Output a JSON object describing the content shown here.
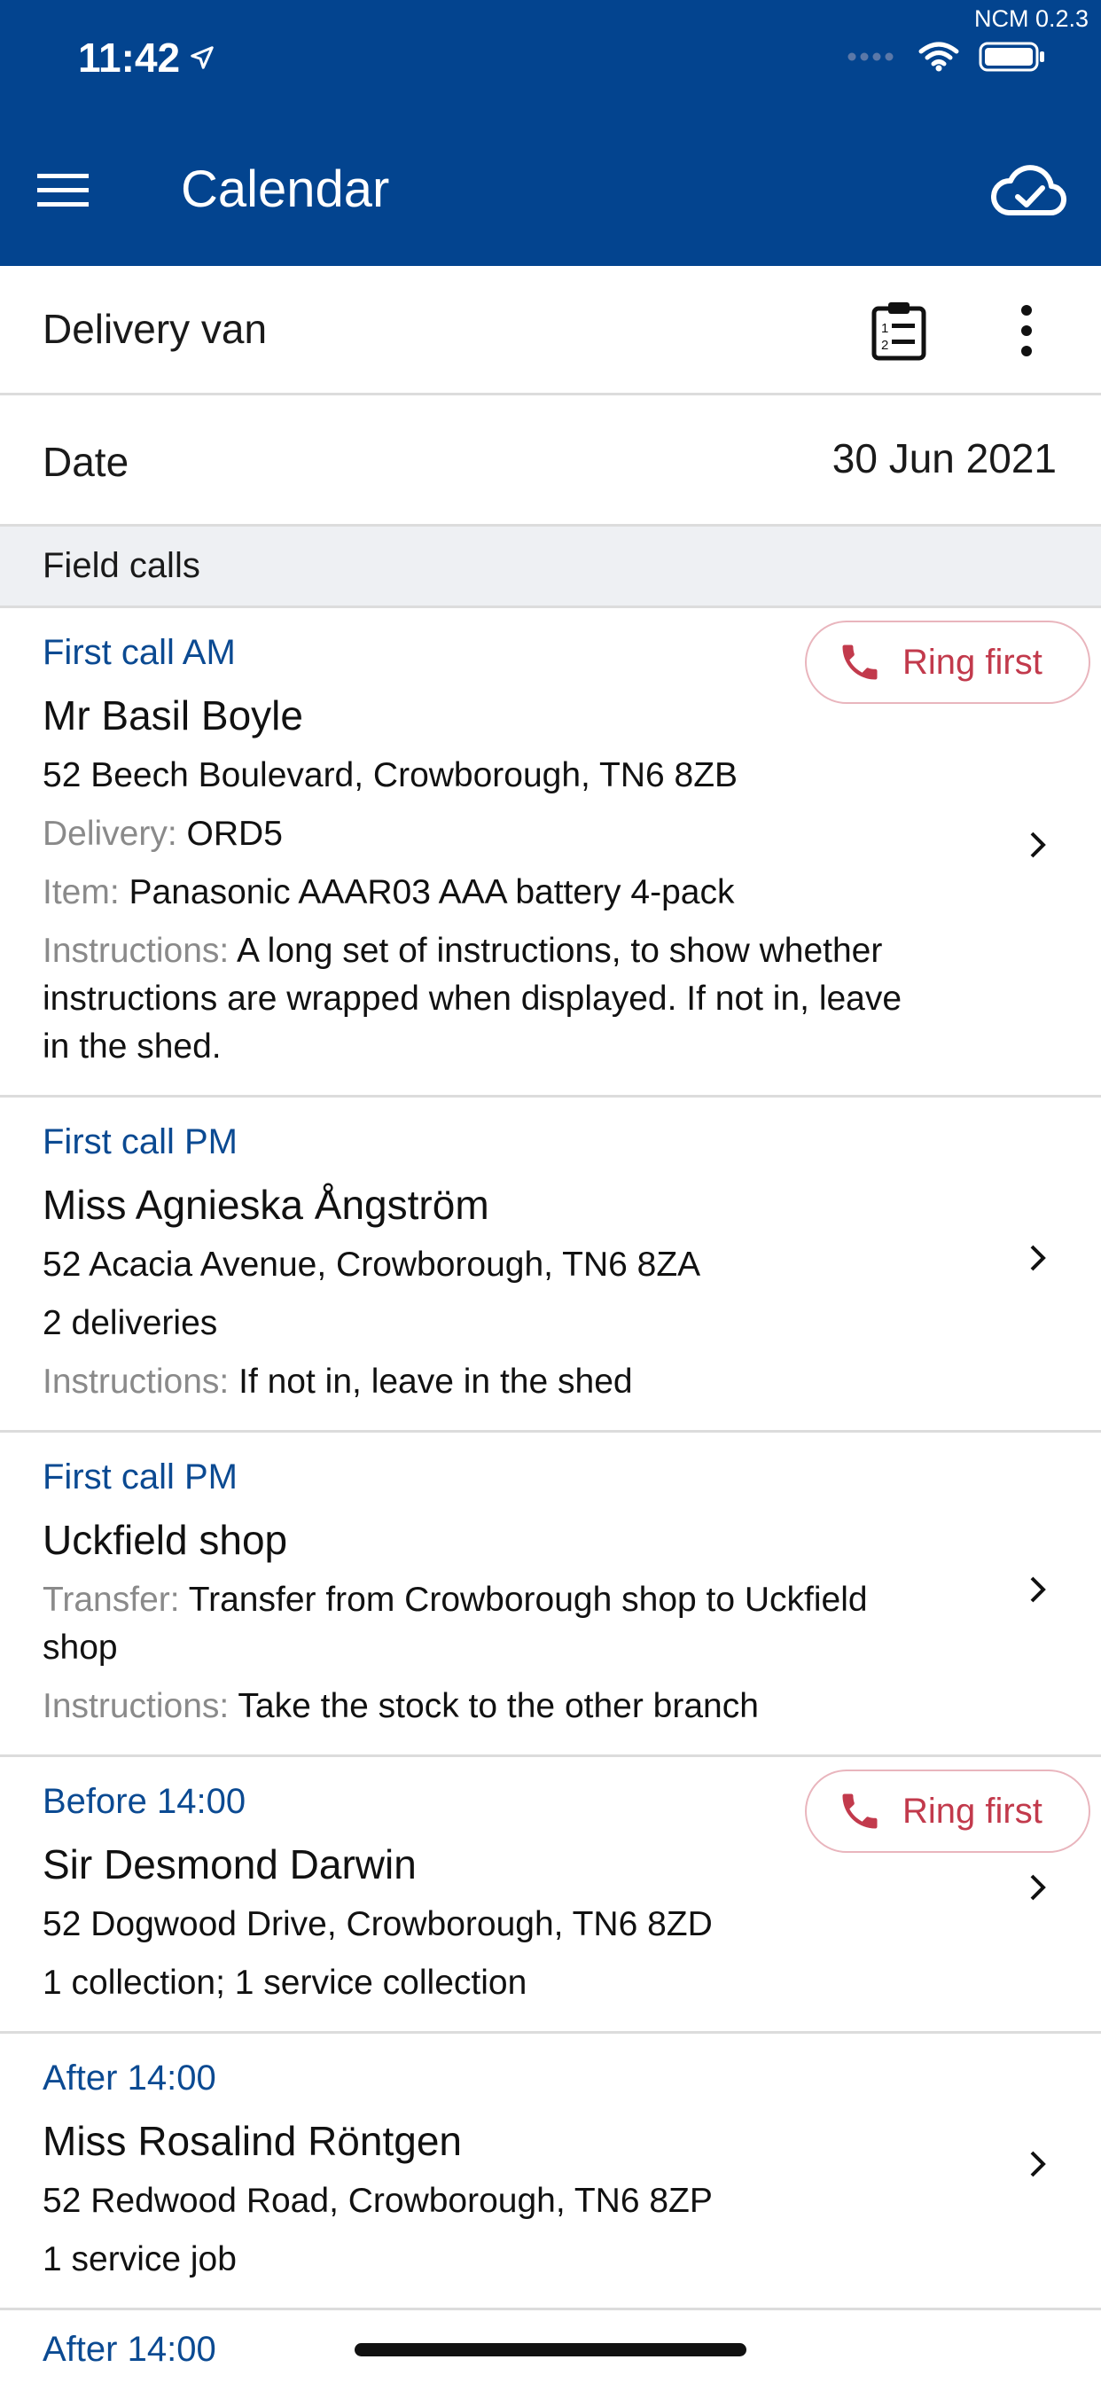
{
  "status_bar": {
    "time": "11:42",
    "version": "NCM 0.2.3"
  },
  "appbar": {
    "title": "Calendar"
  },
  "van": {
    "label": "Delivery van"
  },
  "date": {
    "label": "Date",
    "value": "30 Jun 2021"
  },
  "section": {
    "label": "Field calls"
  },
  "ring_label": "Ring first",
  "calls": [
    {
      "slot": "First call AM",
      "name": "Mr Basil Boyle",
      "address": "52 Beech Boulevard, Crowborough, TN6 8ZB",
      "delivery_label": "Delivery:",
      "delivery_value": "ORD5",
      "item_label": "Item:",
      "item_value": "Panasonic AAAR03 AAA battery 4-pack",
      "instructions_label": "Instructions:",
      "instructions_value": "A long set of instructions, to show whether instructions are wrapped when displayed. If not in, leave in the shed."
    },
    {
      "slot": "First call PM",
      "name": "Miss Agnieska Ångström",
      "address": "52 Acacia Avenue, Crowborough, TN6 8ZA",
      "summary": "2 deliveries",
      "instructions_label": "Instructions:",
      "instructions_value": "If not in, leave in the shed"
    },
    {
      "slot": "First call PM",
      "name": "Uckfield shop",
      "transfer_label": "Transfer:",
      "transfer_value": "Transfer from Crowborough shop to Uckfield shop",
      "instructions_label": "Instructions:",
      "instructions_value": "Take the stock to the other branch"
    },
    {
      "slot": "Before 14:00",
      "name": "Sir Desmond Darwin",
      "address": "52 Dogwood Drive, Crowborough, TN6 8ZD",
      "summary": "1 collection; 1 service collection"
    },
    {
      "slot": "After 14:00",
      "name": "Miss Rosalind Röntgen",
      "address": "52 Redwood Road, Crowborough, TN6 8ZP",
      "summary": "1 service job"
    },
    {
      "slot": "After 14:00"
    }
  ],
  "colors": {
    "header": "#03448f",
    "slot_text": "#0b4a92",
    "ring_red": "#c23a4c",
    "label_grey": "#8a8a8a"
  }
}
